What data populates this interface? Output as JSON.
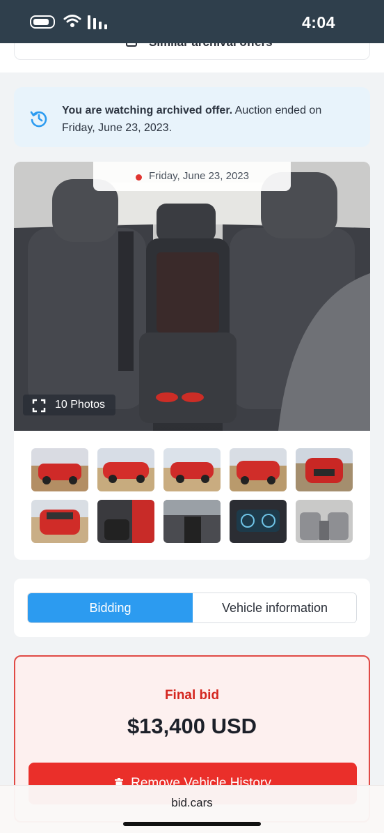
{
  "status_bar": {
    "time": "4:04",
    "icons": [
      "battery-icon",
      "wifi-icon",
      "signal-icon"
    ]
  },
  "similar": {
    "label": "Similar archival offers",
    "icon": "document-icon",
    "chevron": "chevron-down-icon"
  },
  "archived_notice": {
    "bold_text": "You are watching archived offer.",
    "rest_text": " Auction ended on Friday, June 23, 2023.",
    "icon": "history-icon",
    "accent": "#2c9bf0"
  },
  "gallery": {
    "date_label": "Friday, June 23, 2023",
    "photos_count_label": "10 Photos",
    "thumbnails": [
      "front-left-damaged",
      "side-left",
      "rear-left",
      "front-right",
      "front",
      "rear",
      "interior-front",
      "interior-console",
      "instrument-cluster",
      "rear-seat"
    ]
  },
  "tabs": [
    {
      "label": "Bidding",
      "active": true
    },
    {
      "label": "Vehicle information",
      "active": false
    }
  ],
  "bid": {
    "final_label": "Final bid",
    "amount": "$13,400 USD",
    "remove_button": "Remove Vehicle History",
    "accent": "#ea2f2a"
  },
  "browser": {
    "url": "bid.cars"
  }
}
